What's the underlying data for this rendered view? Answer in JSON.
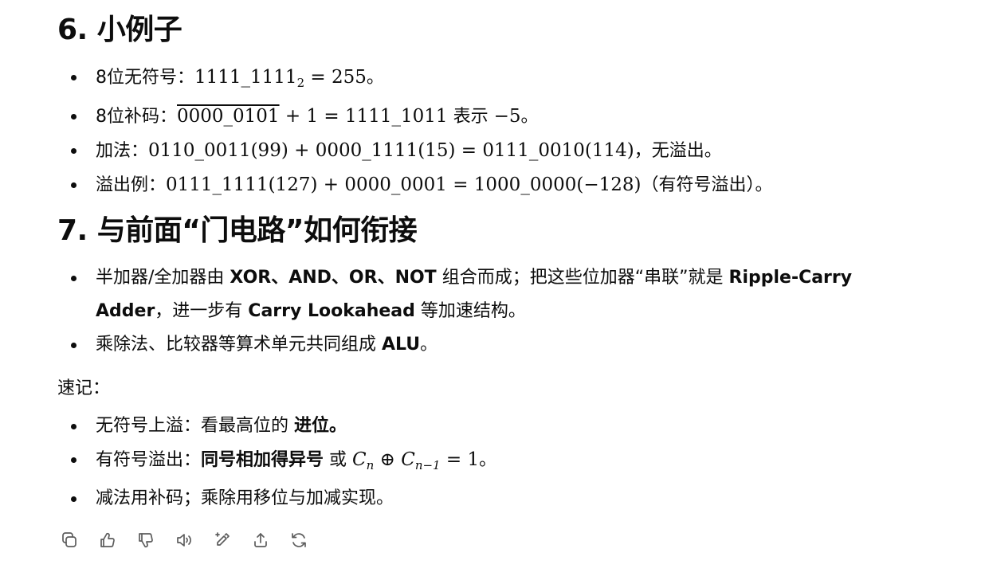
{
  "sec6": {
    "title": "6. 小例子",
    "i1": {
      "label": "8位无符号：",
      "m1": "1111_1111",
      "sub": "2",
      "m2": " = 255",
      "end": "。"
    },
    "i2": {
      "label": "8位补码：",
      "ov": "0000_0101",
      "m": " + 1 = 1111_1011",
      "t": " 表示 ",
      "m2": "−5",
      "end": "。"
    },
    "i3": {
      "label": "加法：",
      "m": "0110_0011(99) + 0000_1111(15) = 0111_0010(114)",
      "end": "，无溢出。"
    },
    "i4": {
      "label": "溢出例：",
      "m": "0111_1111(127) + 0000_0001 = 1000_0000(−128)",
      "end": "（有符号溢出）。"
    }
  },
  "sec7": {
    "title": "7. 与前面“门电路”如何衔接",
    "i1": {
      "t1": "半加器/全加器由 ",
      "b1": "XOR、AND、OR、NOT",
      "t2": " 组合而成；把这些位加器“串联”就是 ",
      "b2": "Ripple-Carry Adder",
      "t3": "，进一步有 ",
      "b3": "Carry Lookahead",
      "t4": " 等加速结构。"
    },
    "i2": {
      "t1": "乘除法、比较器等算术单元共同组成 ",
      "b1": "ALU",
      "end": "。"
    }
  },
  "memo": {
    "label": "速记：",
    "i1": {
      "t": "无符号上溢：看最高位的 ",
      "b": "进位。"
    },
    "i2": {
      "t": "有符号溢出：",
      "b": "同号相加得异号",
      "t2": " 或 ",
      "c1": "C",
      "s1": "n",
      "op": " ⊕ ",
      "c2": "C",
      "s2": "n−1",
      "m": " = 1",
      "end": "。"
    },
    "i3": {
      "t": "减法用补码；乘除用移位与加减实现。"
    }
  },
  "actions": [
    {
      "name": "copy",
      "icon": "copy-icon"
    },
    {
      "name": "thumbs-up",
      "icon": "thumbs-up-icon"
    },
    {
      "name": "thumbs-down",
      "icon": "thumbs-down-icon"
    },
    {
      "name": "read-aloud",
      "icon": "speaker-icon"
    },
    {
      "name": "edit",
      "icon": "edit-sparkle-icon"
    },
    {
      "name": "share",
      "icon": "share-icon"
    },
    {
      "name": "regenerate",
      "icon": "refresh-icon"
    }
  ]
}
